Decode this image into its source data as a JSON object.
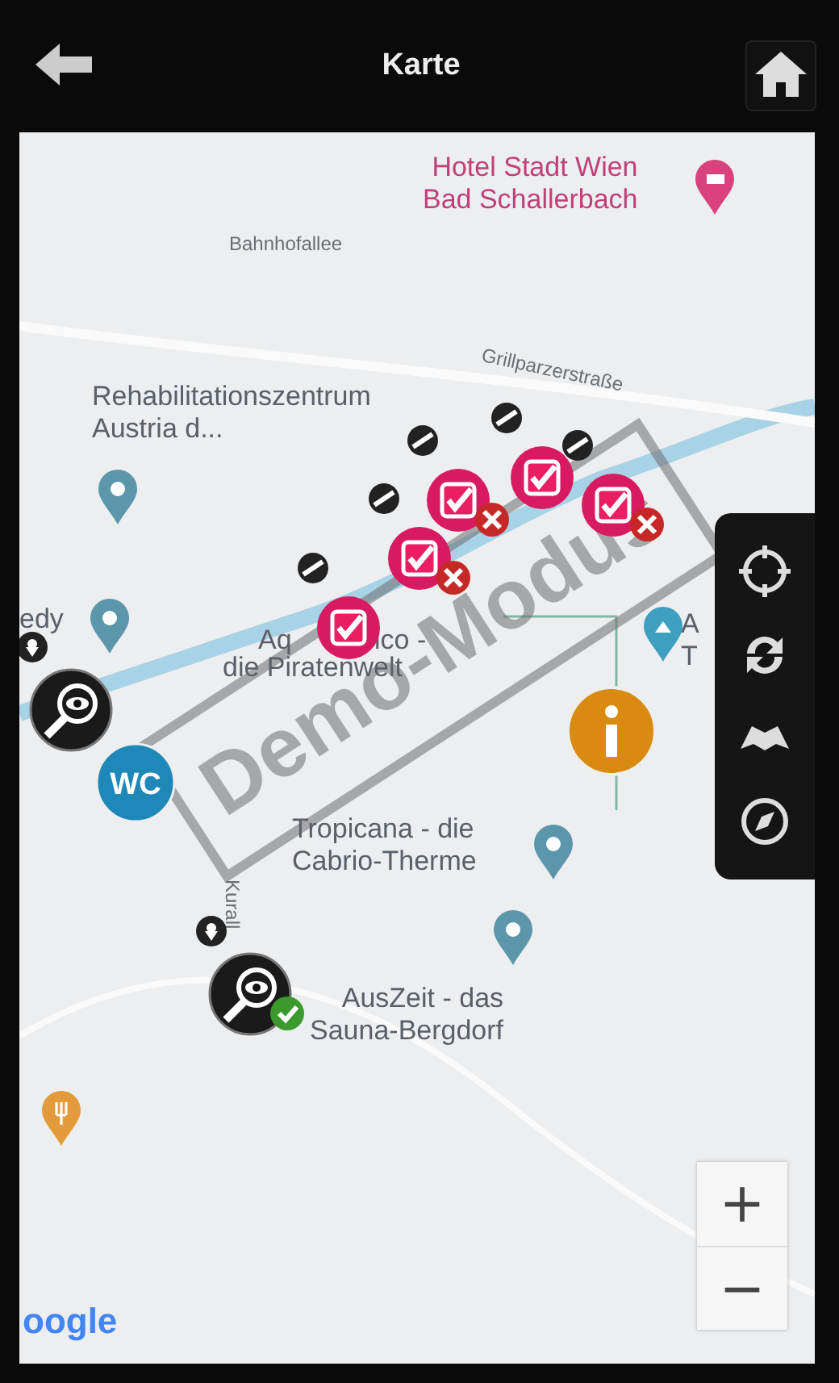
{
  "header": {
    "title": "Karte"
  },
  "map": {
    "labels": [
      {
        "kind": "hotel",
        "lines": [
          "Hotel Stadt Wien",
          "Bad Schallerbach"
        ]
      },
      {
        "kind": "street",
        "lines": [
          "Bahnhofallee"
        ]
      },
      {
        "kind": "street-tilted",
        "lines": [
          "Grillparzerstraße"
        ]
      },
      {
        "kind": "poi",
        "lines": [
          "Rehabilitationszentrum",
          "Austria d..."
        ]
      },
      {
        "kind": "poi",
        "lines": [
          "edy"
        ]
      },
      {
        "kind": "poi",
        "lines": [
          "Aq"
        ]
      },
      {
        "kind": "poi",
        "lines": [
          "ico -"
        ]
      },
      {
        "kind": "poi",
        "lines": [
          "die Piratenwelt"
        ]
      },
      {
        "kind": "poi",
        "lines": [
          "A",
          "T"
        ]
      },
      {
        "kind": "poi",
        "lines": [
          "Tropicana - die",
          "Cabrio-Therme"
        ]
      },
      {
        "kind": "street-vertical",
        "lines": [
          "Kurall"
        ]
      },
      {
        "kind": "poi-right",
        "lines": [
          "AusZeit - das",
          "Sauna-Bergdorf"
        ]
      }
    ],
    "pins": [
      {
        "kind": "hotel"
      },
      {
        "kind": "place"
      },
      {
        "kind": "place"
      },
      {
        "kind": "place"
      },
      {
        "kind": "place"
      },
      {
        "kind": "attraction"
      },
      {
        "kind": "food"
      }
    ],
    "markers": [
      {
        "kind": "task",
        "declined": true
      },
      {
        "kind": "task",
        "declined": false
      },
      {
        "kind": "task",
        "declined": true
      },
      {
        "kind": "task",
        "declined": true
      },
      {
        "kind": "task",
        "declined": false
      },
      {
        "kind": "search",
        "confirmed": false
      },
      {
        "kind": "wc",
        "text": "WC"
      },
      {
        "kind": "info"
      },
      {
        "kind": "search",
        "confirmed": true
      }
    ],
    "stamp": "Demo-Modus",
    "attribution": "oogle",
    "zoom": {
      "plus": "+",
      "minus": "−"
    }
  }
}
